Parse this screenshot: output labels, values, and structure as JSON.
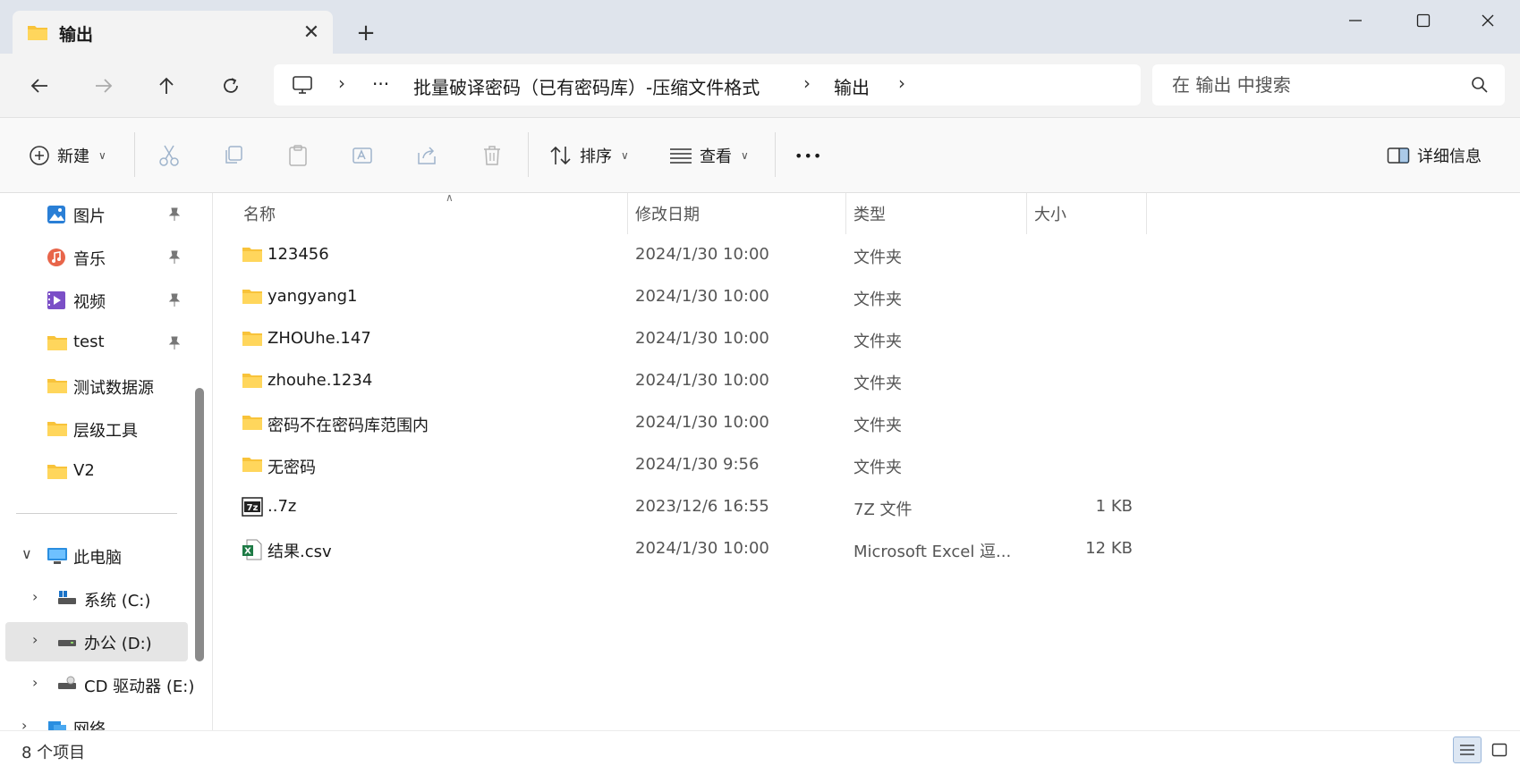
{
  "window": {
    "tab_title": "输出",
    "tab_close": "✕",
    "new_tab": "+"
  },
  "nav": {
    "breadcrumbs": [
      "批量破译密码（已有密码库）-压缩文件格式",
      "输出"
    ],
    "ellipsis": "···",
    "search_placeholder": "在 输出 中搜索"
  },
  "toolbar": {
    "new_label": "新建",
    "sort_label": "排序",
    "view_label": "查看",
    "more_label": "•••",
    "details_label": "详细信息"
  },
  "sidebar": {
    "quick_access": [
      {
        "label": "图片",
        "icon": "pictures-icon"
      },
      {
        "label": "音乐",
        "icon": "music-icon"
      },
      {
        "label": "视频",
        "icon": "video-icon"
      },
      {
        "label": "test",
        "icon": "folder-icon"
      },
      {
        "label": "测试数据源",
        "icon": "folder-icon"
      },
      {
        "label": "层级工具",
        "icon": "folder-icon"
      },
      {
        "label": "V2",
        "icon": "folder-icon"
      }
    ],
    "this_pc": "此电脑",
    "drives": [
      {
        "label": "系统 (C:)",
        "selected": false
      },
      {
        "label": "办公 (D:)",
        "selected": true
      },
      {
        "label": "CD 驱动器 (E:)",
        "selected": false
      }
    ],
    "network": "网络"
  },
  "columns": {
    "name": "名称",
    "date": "修改日期",
    "type": "类型",
    "size": "大小"
  },
  "files": [
    {
      "name": "123456",
      "date": "2024/1/30 10:00",
      "type": "文件夹",
      "size": "",
      "kind": "folder"
    },
    {
      "name": "yangyang1",
      "date": "2024/1/30 10:00",
      "type": "文件夹",
      "size": "",
      "kind": "folder"
    },
    {
      "name": "ZHOUhe.147",
      "date": "2024/1/30 10:00",
      "type": "文件夹",
      "size": "",
      "kind": "folder"
    },
    {
      "name": "zhouhe.1234",
      "date": "2024/1/30 10:00",
      "type": "文件夹",
      "size": "",
      "kind": "folder"
    },
    {
      "name": "密码不在密码库范围内",
      "date": "2024/1/30 10:00",
      "type": "文件夹",
      "size": "",
      "kind": "folder"
    },
    {
      "name": "无密码",
      "date": "2024/1/30 9:56",
      "type": "文件夹",
      "size": "",
      "kind": "folder"
    },
    {
      "name": "..7z",
      "date": "2023/12/6 16:55",
      "type": "7Z 文件",
      "size": "1 KB",
      "kind": "7z"
    },
    {
      "name": "结果.csv",
      "date": "2024/1/30 10:00",
      "type": "Microsoft Excel 逗...",
      "size": "12 KB",
      "kind": "excel"
    }
  ],
  "status": {
    "item_count": "8 个项目"
  },
  "colors": {
    "folder_yellow": "#f8c33a",
    "accent_blue": "#1a73c8",
    "excel_green": "#1d7a45"
  }
}
